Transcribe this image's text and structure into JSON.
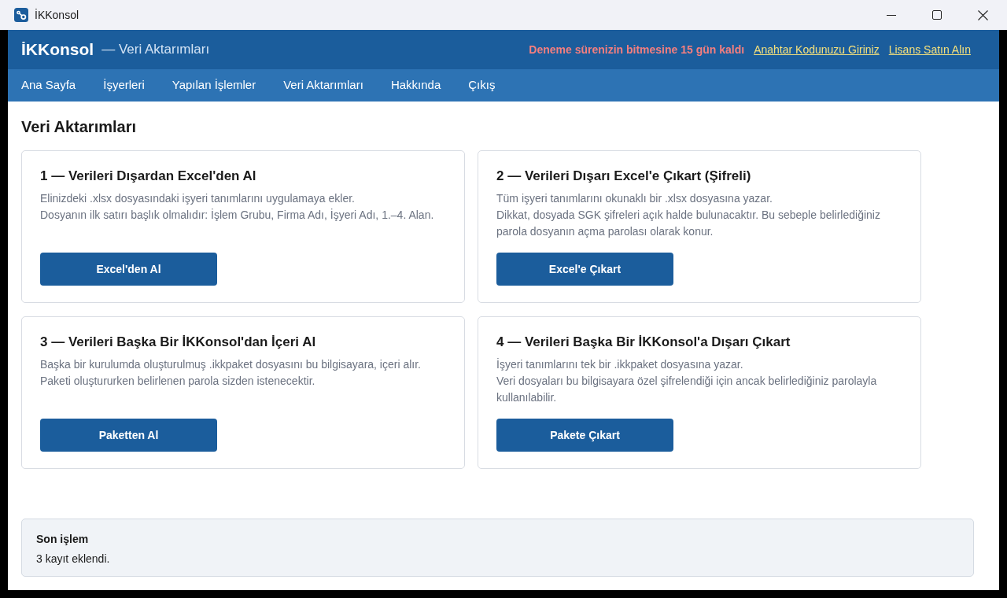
{
  "window": {
    "title": "İKKonsol"
  },
  "header": {
    "brand": "İKKonsol",
    "subtitle": "— Veri Aktarımları",
    "trial_notice": "Deneme sürenizin bitmesine 15 gün kaldı",
    "links": [
      "Anahtar Kodunuzu Giriniz",
      "Lisans Satın Alın"
    ]
  },
  "nav": [
    "Ana Sayfa",
    "İşyerleri",
    "Yapılan İşlemler",
    "Veri Aktarımları",
    "Hakkında",
    "Çıkış"
  ],
  "page_title": "Veri Aktarımları",
  "cards": [
    {
      "title": "1 — Verileri Dışardan Excel'den Al",
      "description": [
        "Elinizdeki .xlsx dosyasındaki işyeri tanımlarını uygulamaya ekler.",
        "Dosyanın ilk satırı başlık olmalıdır: İşlem Grubu, Firma Adı, İşyeri Adı, 1.–4. Alan."
      ],
      "button": "Excel'den Al"
    },
    {
      "title": "2 — Verileri Dışarı Excel'e Çıkart (Şifreli)",
      "description": [
        "Tüm işyeri tanımlarını okunaklı bir .xlsx dosyasına yazar.",
        "Dikkat, dosyada SGK şifreleri açık halde bulunacaktır. Bu sebeple belirlediğiniz parola dosyanın açma parolası olarak konur."
      ],
      "button": "Excel'e Çıkart"
    },
    {
      "title": "3 — Verileri Başka Bir İKKonsol'dan İçeri Al",
      "description": [
        "Başka bir kurulumda oluşturulmuş .ikkpaket dosyasını bu bilgisayara, içeri alır.",
        "Paketi oluştururken belirlenen parola sizden istenecektir."
      ],
      "button": "Paketten Al"
    },
    {
      "title": "4 — Verileri Başka Bir İKKonsol'a Dışarı Çıkart",
      "description": [
        "İşyeri tanımlarını tek bir .ikkpaket dosyasına yazar.",
        "Veri dosyaları bu bilgisayara özel şifrelendiği için ancak belirlediğiniz parolayla kullanılabilir."
      ],
      "button": "Pakete Çıkart"
    }
  ],
  "last_action": {
    "title": "Son işlem",
    "message": "3 kayıt eklendi."
  }
}
